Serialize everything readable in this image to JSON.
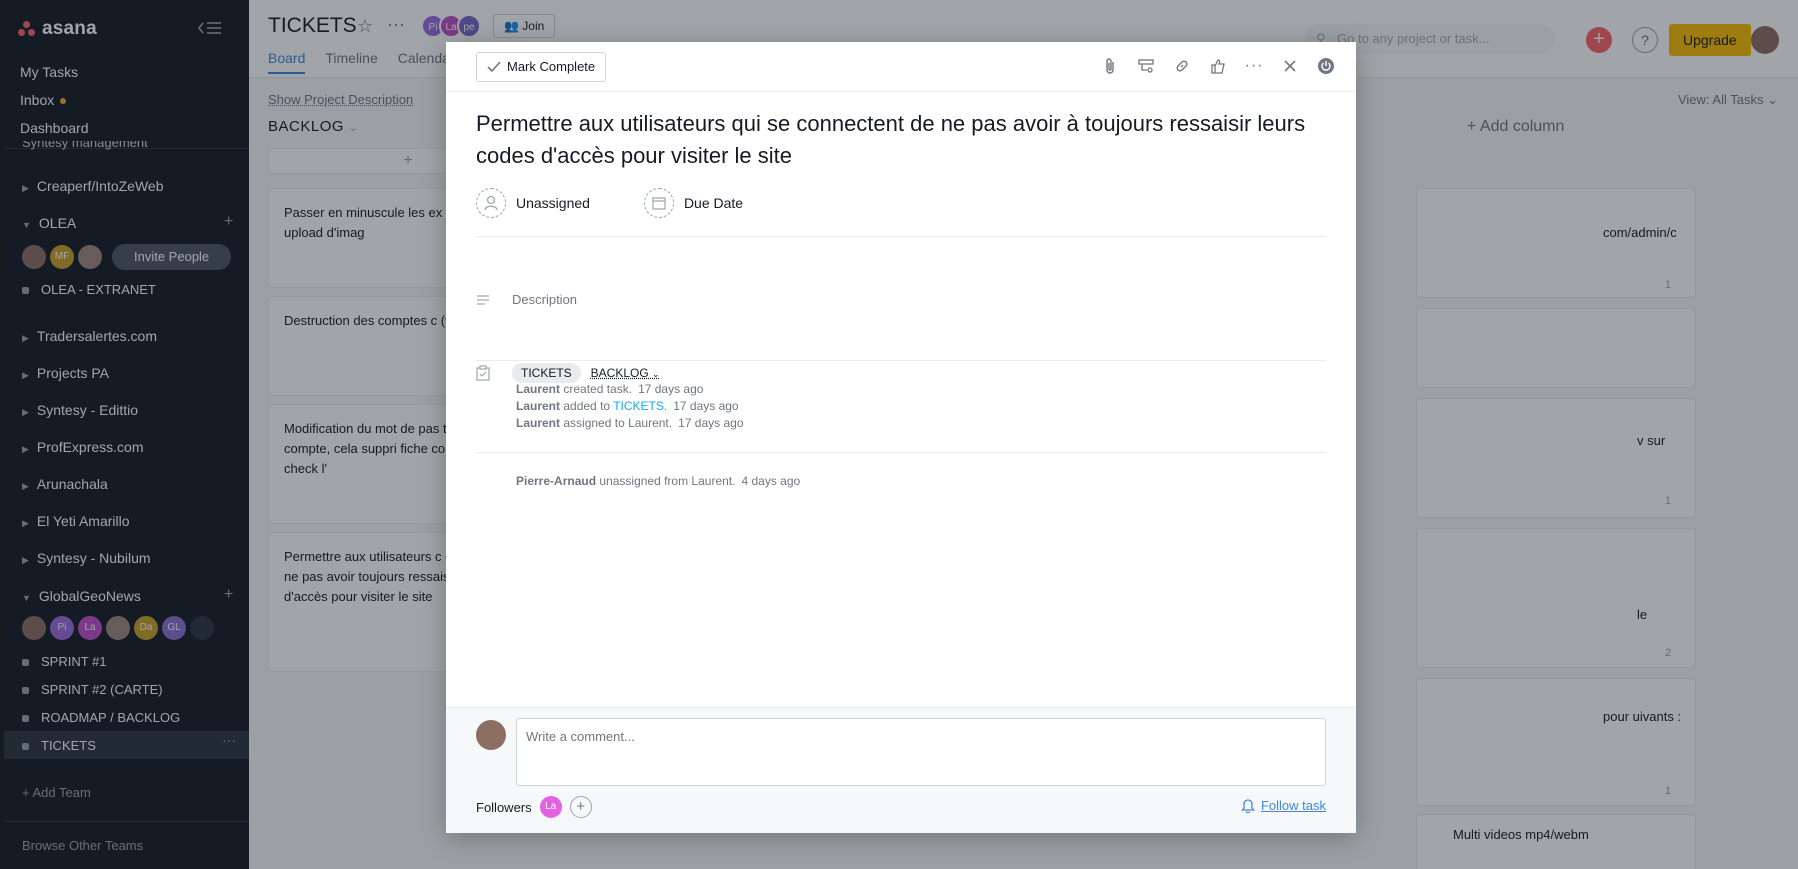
{
  "sidebar": {
    "brand": "asana",
    "nav": {
      "my_tasks": "My Tasks",
      "inbox": "Inbox",
      "dashboard": "Dashboard"
    },
    "cut_item": "Syntesy management",
    "teams": [
      {
        "name": "Creaperf/IntoZeWeb"
      },
      {
        "name": "OLEA"
      },
      {
        "name": "Tradersalertes.com"
      },
      {
        "name": "Projects PA"
      },
      {
        "name": "Syntesy - Edittio"
      },
      {
        "name": "ProfExpress.com"
      },
      {
        "name": "Arunachala"
      },
      {
        "name": "El Yeti Amarillo"
      },
      {
        "name": "Syntesy - Nubilum"
      },
      {
        "name": "GlobalGeoNews"
      }
    ],
    "olea_members": [
      "",
      "MF",
      ""
    ],
    "invite_label": "Invite People",
    "olea_projects": [
      "OLEA - EXTRANET"
    ],
    "ggn_members": [
      "",
      "Pi",
      "La",
      "",
      "Da",
      "GL",
      ""
    ],
    "ggn_projects": [
      "SPRINT #1",
      "SPRINT #2 (CARTE)",
      "ROADMAP / BACKLOG",
      "TICKETS"
    ],
    "add_team": "Add Team",
    "browse_teams": "Browse Other Teams"
  },
  "topbar": {
    "project_title": "TICKETS",
    "members": [
      "Pi",
      "La",
      "pe"
    ],
    "join_label": "Join",
    "tabs": [
      "Board",
      "Timeline",
      "Calendar"
    ],
    "search_placeholder": "Go to any project or task...",
    "help": "?",
    "upgrade": "Upgrade"
  },
  "board": {
    "show_description": "Show Project Description",
    "view_all": "View: All Tasks",
    "column_name": "BACKLOG",
    "add_column": "+ Add column",
    "cards": [
      "Passer en minuscule les ex de toutes les upload d'imag",
      "Destruction des comptes c (voir PA & Eric)",
      "Modification du mot de pas tout les compte, cela suppri fiche contributeur, check l'",
      "Permettre aux utilisateurs c connectent de ne pas avoir toujours ressaisir leurs cod d'accès pour visiter le site"
    ],
    "right_cards": [
      {
        "text": "com/admin/c",
        "count": "1"
      },
      {
        "text": "",
        "count": ""
      },
      {
        "text": "v sur",
        "count": "1"
      },
      {
        "text": "le",
        "count": "2"
      },
      {
        "text": "pour uivants :",
        "count": "1"
      },
      {
        "text": "Multi videos mp4/webm",
        "count": ""
      }
    ]
  },
  "task": {
    "mark_complete": "Mark Complete",
    "title": "Permettre aux utilisateurs qui se connectent de ne pas avoir à toujours ressaisir leurs codes d'accès pour visiter le site",
    "assignee": "Unassigned",
    "due_date": "Due Date",
    "description_placeholder": "Description",
    "project_pill": "TICKETS",
    "section": "BACKLOG",
    "stories": [
      {
        "actor": "Laurent",
        "action": "created task.",
        "link": "",
        "when": "17 days ago"
      },
      {
        "actor": "Laurent",
        "action": "added to",
        "link": "TICKETS.",
        "when": "17 days ago"
      },
      {
        "actor": "Laurent",
        "action": "assigned to Laurent.",
        "link": "",
        "when": "17 days ago"
      },
      {
        "actor": "Pierre-Arnaud",
        "action": "unassigned from Laurent.",
        "link": "",
        "when": "4 days ago"
      }
    ],
    "comment_placeholder": "Write a comment...",
    "followers_label": "Followers",
    "follower_initials": "La",
    "follow_task": "Follow task"
  },
  "colors": {
    "sidebar_bg": "#151b26",
    "accent_blue": "#4186e0",
    "link_blue": "#14aaf5",
    "brand_coral": "#fc636b",
    "upgrade_yellow": "#fcbd01",
    "follower_pink": "#e362e3"
  },
  "icons": [
    "collapse-sidebar-icon",
    "star-icon",
    "more-icon",
    "people-icon",
    "search-icon",
    "check-icon",
    "attachment-icon",
    "subtask-icon",
    "link-icon",
    "like-icon",
    "close-icon",
    "power-icon",
    "person-icon",
    "calendar-icon",
    "description-icon",
    "clipboard-icon",
    "bell-icon",
    "add-follower-icon"
  ]
}
